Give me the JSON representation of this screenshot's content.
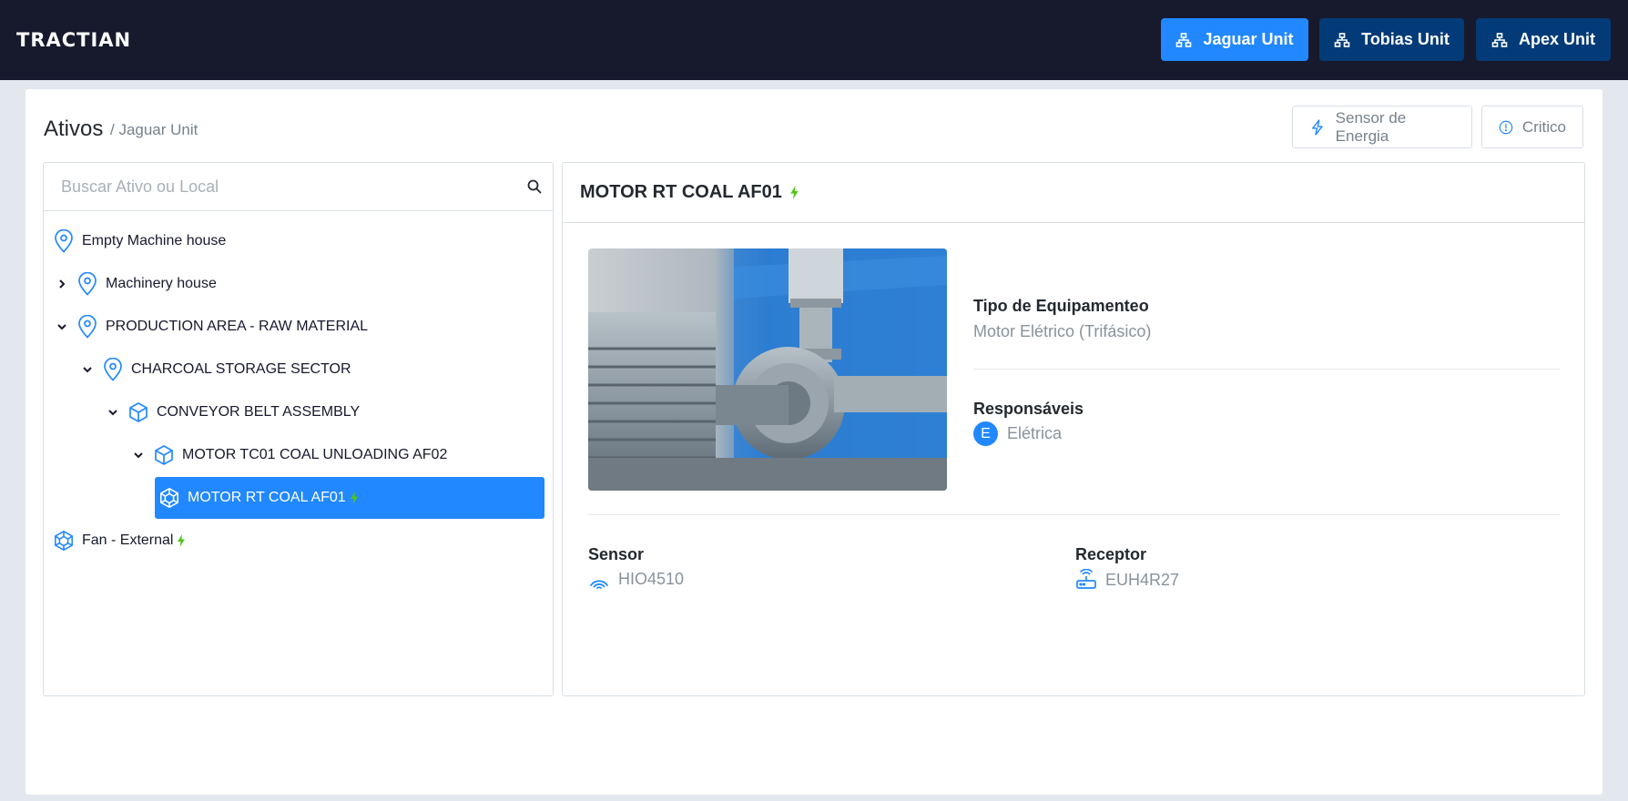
{
  "header": {
    "logo_text": "TRACTIAN",
    "units": [
      {
        "label": "Jaguar Unit",
        "active": true
      },
      {
        "label": "Tobias Unit",
        "active": false
      },
      {
        "label": "Apex Unit",
        "active": false
      }
    ]
  },
  "page": {
    "title": "Ativos",
    "breadcrumb": "/ Jaguar Unit",
    "filters": {
      "energy_sensor": "Sensor de Energia",
      "critical": "Critico"
    }
  },
  "tree": {
    "search_placeholder": "Buscar Ativo ou Local",
    "items": [
      {
        "label": "Empty Machine house",
        "type": "location",
        "depth": 0,
        "expander": "none"
      },
      {
        "label": "Machinery house",
        "type": "location",
        "depth": 0,
        "expander": "collapsed"
      },
      {
        "label": "PRODUCTION AREA - RAW MATERIAL",
        "type": "location",
        "depth": 0,
        "expander": "expanded"
      },
      {
        "label": "CHARCOAL STORAGE SECTOR",
        "type": "location",
        "depth": 1,
        "expander": "expanded"
      },
      {
        "label": "CONVEYOR BELT ASSEMBLY",
        "type": "asset",
        "depth": 2,
        "expander": "expanded"
      },
      {
        "label": "MOTOR TC01 COAL UNLOADING AF02",
        "type": "asset",
        "depth": 3,
        "expander": "expanded"
      },
      {
        "label": "MOTOR RT COAL AF01",
        "type": "component",
        "depth": 4,
        "expander": "none",
        "selected": true,
        "energy": true
      },
      {
        "label": "Fan - External",
        "type": "component",
        "depth": 0,
        "expander": "none",
        "energy": true
      }
    ]
  },
  "detail": {
    "title": "MOTOR RT COAL AF01",
    "equipment_type_label": "Tipo de Equipamenteo",
    "equipment_type_value": "Motor Elétrico (Trifásico)",
    "responsible_label": "Responsáveis",
    "responsible_initial": "E",
    "responsible_value": "Elétrica",
    "sensor_label": "Sensor",
    "sensor_value": "HIO4510",
    "receiver_label": "Receptor",
    "receiver_value": "EUH4R27"
  },
  "colors": {
    "header_bg": "#17192d",
    "primary": "#2188ff",
    "unit_inactive": "#023b78",
    "energy_green": "#52c41a"
  }
}
